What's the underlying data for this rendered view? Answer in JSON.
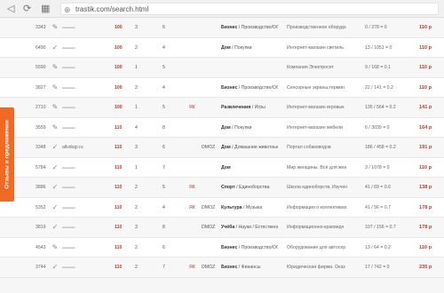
{
  "browser": {
    "back_glyph": "◁",
    "forward_glyph": "⟳",
    "apps_glyph": "▦",
    "url": "trastik.com/search.html"
  },
  "feedback_tab": {
    "label": "Отзывы и предложения"
  },
  "rows": [
    {
      "id": "3343",
      "domain": "",
      "price": "100",
      "n1": "3",
      "n2": "6",
      "yandex": "",
      "dmoz": "",
      "cat_main": "Бизнес",
      "cat_sub": "Производство/Оборудова",
      "desc": "Производственное оборудо",
      "stats": "0 / 278 = 0",
      "price_total": "110 р"
    },
    {
      "id": "6490",
      "domain": "",
      "price": "100",
      "n1": "2",
      "n2": "4",
      "yandex": "",
      "dmoz": "",
      "cat_main": "Дом",
      "cat_sub": "Покупки",
      "desc": "Интернет-магазин светиль",
      "stats": "13 / 1051 = 0",
      "price_total": "110 р"
    },
    {
      "id": "5590",
      "domain": "",
      "price": "100",
      "n1": "1",
      "n2": "5",
      "yandex": "",
      "dmoz": "",
      "cat_main": "",
      "cat_sub": "",
      "desc": "Компания Электросет",
      "stats": "9 / 168 = 0.1",
      "price_total": "110 р"
    },
    {
      "id": "3827",
      "domain": "",
      "price": "100",
      "n1": "2",
      "n2": "4",
      "yandex": "",
      "dmoz": "",
      "cat_main": "Бизнес",
      "cat_sub": "Производство/Оборудова",
      "desc": "Сенсорные экраны,термин",
      "stats": "22 / 141 = 0.2",
      "price_total": "110 р"
    },
    {
      "id": "2710",
      "domain": "",
      "price": "100",
      "n1": "1",
      "n2": "5",
      "yandex": "ЯК",
      "dmoz": "",
      "cat_main": "Развлечения",
      "cat_sub": "Игры",
      "desc": "Интернет-магазин игровых",
      "stats": "135 / 564 = 0.2",
      "price_total": "141 р"
    },
    {
      "id": "3559",
      "domain": "",
      "price": "110",
      "n1": "4",
      "n2": "8",
      "yandex": "",
      "dmoz": "",
      "cat_main": "Дом",
      "cat_sub": "Покупки",
      "desc": "Интернет-магазин мебели",
      "stats": "6 / 3039 = 0",
      "price_total": "164 р"
    },
    {
      "id": "3348",
      "domain": "allvdogi.ru",
      "price": "110",
      "n1": "3",
      "n2": "6",
      "yandex": "",
      "dmoz": "DMOZ",
      "cat_main": "Дом",
      "cat_sub": "Домашние животные",
      "desc": "Портал собаководов",
      "stats": "186 / 458 = 0.2",
      "price_total": "191 р"
    },
    {
      "id": "5784",
      "domain": "",
      "price": "110",
      "n1": "1",
      "n2": "7",
      "yandex": "",
      "dmoz": "",
      "cat_main": "Дом",
      "cat_sub": "",
      "desc": "Мир женщины. Всё для жен",
      "stats": "3 / 1078 = 0",
      "price_total": "110 р"
    },
    {
      "id": "3886",
      "domain": "",
      "price": "110",
      "n1": "2",
      "n2": "5",
      "yandex": "ЯК",
      "dmoz": "",
      "cat_main": "Спорт",
      "cat_sub": "Единоборства",
      "desc": "Школа единоборств, Изучен",
      "stats": "41 / 69 = 0.6",
      "price_total": "138 р"
    },
    {
      "id": "5352",
      "domain": "",
      "price": "110",
      "n1": "2",
      "n2": "4",
      "yandex": "ЯК",
      "dmoz": "DMOZ",
      "cat_main": "Культура",
      "cat_sub": "Музыка",
      "desc": "Информация о коллективах",
      "stats": "41 / 56 = 0.7",
      "price_total": "178 р"
    },
    {
      "id": "3819",
      "domain": "",
      "price": "110",
      "n1": "3",
      "n2": "8",
      "yandex": "",
      "dmoz": "DMOZ",
      "cat_main": "Учёба",
      "cat_sub": "Науки / Естественные",
      "desc": "Информационно-краеведч",
      "stats": "107 / 156 = 0.7",
      "price_total": "178 р"
    },
    {
      "id": "4543",
      "domain": "",
      "price": "110",
      "n1": "2",
      "n2": "6",
      "yandex": "",
      "dmoz": "",
      "cat_main": "Бизнес",
      "cat_sub": "Производство/Оборудова",
      "desc": "Оборудование для автосер",
      "stats": "13 / 64 = 0.2",
      "price_total": "110 р"
    },
    {
      "id": "3744",
      "domain": "",
      "price": "110",
      "n1": "2",
      "n2": "7",
      "yandex": "ЯК",
      "dmoz": "DMOZ",
      "cat_main": "Бизнес",
      "cat_sub": "Финансы",
      "desc": "Юридическая фирма. Оказ",
      "stats": "17 / 742 = 0",
      "price_total": "235 р"
    }
  ]
}
